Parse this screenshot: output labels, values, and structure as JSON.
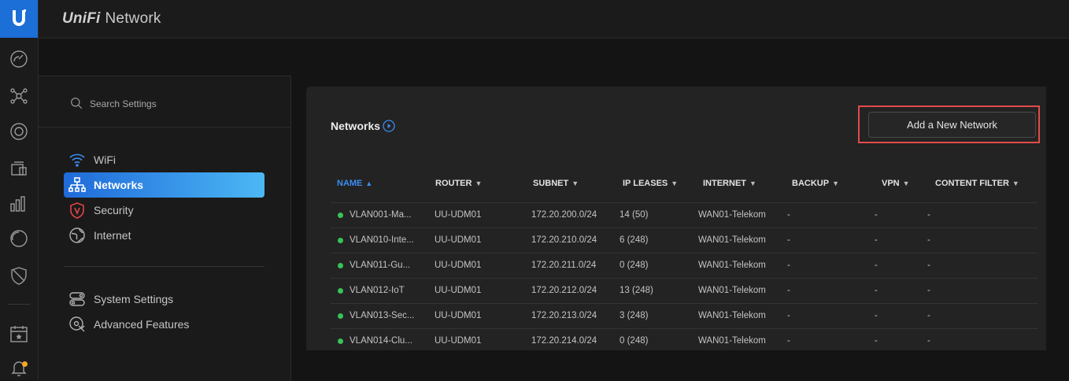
{
  "app": {
    "brand_logo": "UniFi",
    "brand_name": "Network"
  },
  "rail": {
    "icons": [
      "dashboard-icon",
      "topology-icon",
      "devices-icon",
      "clients-icon",
      "statistics-icon",
      "insights-icon",
      "security-shield-icon",
      "events-calendar-icon",
      "alerts-bell-icon"
    ]
  },
  "settings": {
    "search_placeholder": "Search Settings",
    "nav": [
      {
        "label": "WiFi",
        "icon": "wifi-icon",
        "active": false
      },
      {
        "label": "Networks",
        "icon": "networks-icon",
        "active": true
      },
      {
        "label": "Security",
        "icon": "security-icon",
        "active": false
      },
      {
        "label": "Internet",
        "icon": "internet-globe-icon",
        "active": false
      }
    ],
    "nav2": [
      {
        "label": "System Settings",
        "icon": "system-settings-icon"
      },
      {
        "label": "Advanced Features",
        "icon": "advanced-features-icon"
      }
    ]
  },
  "networks": {
    "title": "Networks",
    "add_button": "Add a New Network",
    "columns": [
      "NAME",
      "ROUTER",
      "SUBNET",
      "IP LEASES",
      "INTERNET",
      "BACKUP",
      "VPN",
      "CONTENT FILTER"
    ],
    "sorted_column": "NAME",
    "rows": [
      {
        "name": "VLAN001-Ma...",
        "router": "UU-UDM01",
        "subnet": "172.20.200.0/24",
        "leases": "14 (50)",
        "internet": "WAN01-Telekom",
        "backup": "-",
        "vpn": "-",
        "filter": "-"
      },
      {
        "name": "VLAN010-Inte...",
        "router": "UU-UDM01",
        "subnet": "172.20.210.0/24",
        "leases": "6 (248)",
        "internet": "WAN01-Telekom",
        "backup": "-",
        "vpn": "-",
        "filter": "-"
      },
      {
        "name": "VLAN011-Gu...",
        "router": "UU-UDM01",
        "subnet": "172.20.211.0/24",
        "leases": "0 (248)",
        "internet": "WAN01-Telekom",
        "backup": "-",
        "vpn": "-",
        "filter": "-"
      },
      {
        "name": "VLAN012-IoT",
        "router": "UU-UDM01",
        "subnet": "172.20.212.0/24",
        "leases": "13 (248)",
        "internet": "WAN01-Telekom",
        "backup": "-",
        "vpn": "-",
        "filter": "-"
      },
      {
        "name": "VLAN013-Sec...",
        "router": "UU-UDM01",
        "subnet": "172.20.213.0/24",
        "leases": "3 (248)",
        "internet": "WAN01-Telekom",
        "backup": "-",
        "vpn": "-",
        "filter": "-"
      },
      {
        "name": "VLAN014-Clu...",
        "router": "UU-UDM01",
        "subnet": "172.20.214.0/24",
        "leases": "0 (248)",
        "internet": "WAN01-Telekom",
        "backup": "-",
        "vpn": "-",
        "filter": "-"
      }
    ]
  },
  "colors": {
    "accent": "#1b6fd6",
    "highlight": "#e24a4a",
    "status_online": "#38c25a",
    "alert_dot": "#f5a623"
  }
}
